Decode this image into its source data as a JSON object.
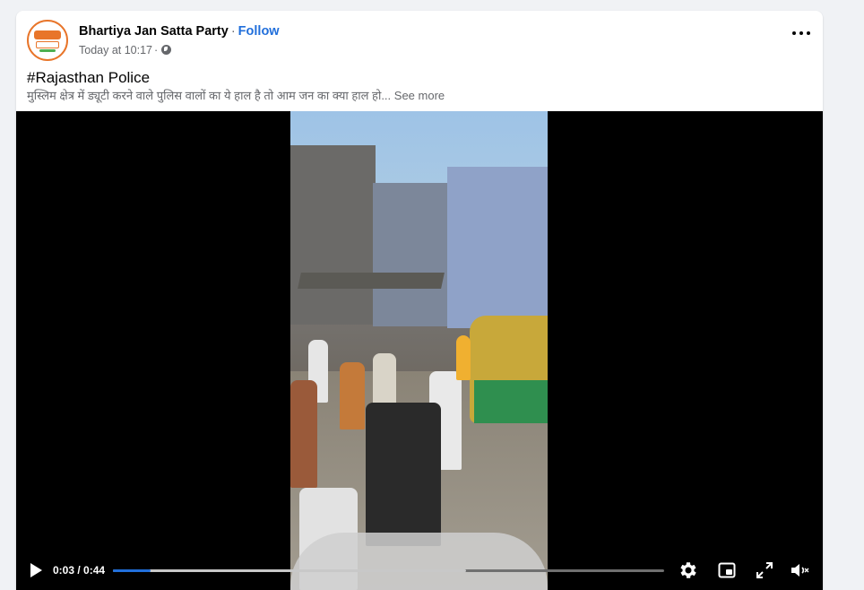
{
  "post": {
    "page_name": "Bhartiya Jan Satta Party",
    "separator": "·",
    "follow_label": "Follow",
    "timestamp": "Today at 10:17",
    "time_separator": "·",
    "privacy_icon": "globe-icon",
    "title": "#Rajasthan Police",
    "text": "मुस्लिम क्षेत्र में ड्यूटी करने वाले पुलिस वालों का ये हाल है तो आम जन का क्या हाल हो...",
    "see_more_label": "See more",
    "more_icon": "more-options-icon"
  },
  "video": {
    "current_time": "0:03",
    "duration": "0:44",
    "time_display": "0:03 / 0:44",
    "progress_fraction": 0.068,
    "buffered_fraction": 0.64,
    "controls": {
      "play_icon": "play-icon",
      "settings_icon": "gear-icon",
      "pip_icon": "picture-in-picture-icon",
      "fullscreen_icon": "fullscreen-icon",
      "mute_icon": "muted-speaker-icon"
    }
  },
  "colors": {
    "link": "#216fdb",
    "progress_played": "#216fdb",
    "avatar_accent": "#e8752a"
  }
}
